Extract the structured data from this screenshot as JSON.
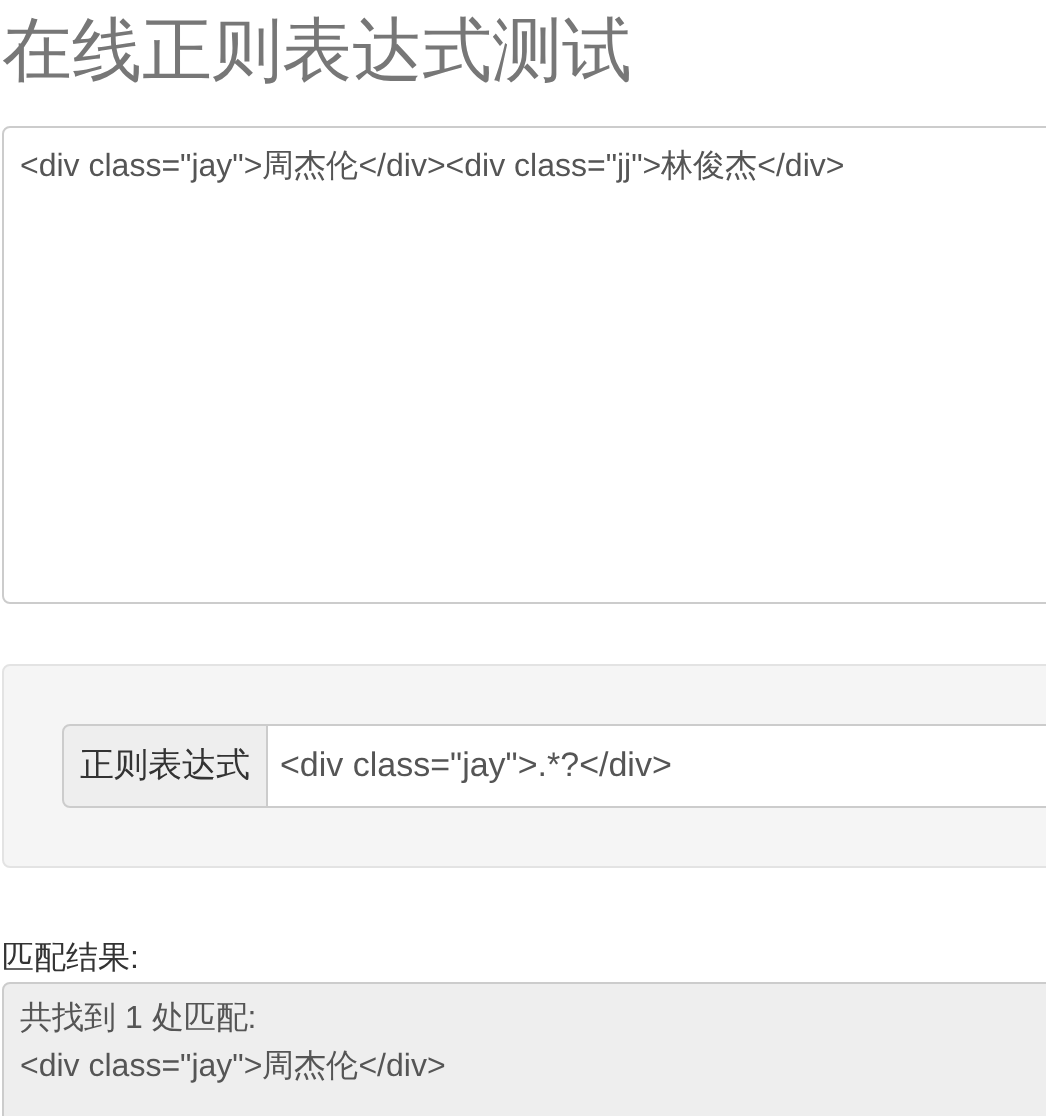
{
  "title": "在线正则表达式测试",
  "source_text": {
    "value": "<div class=\"jay\">周杰伦</div><div class=\"jj\">林俊杰</div>"
  },
  "regex": {
    "label": "正则表达式",
    "value": "<div class=\"jay\">.*?</div>"
  },
  "result": {
    "label": "匹配结果:",
    "lines": [
      "共找到 1 处匹配:",
      "<div class=\"jay\">周杰伦</div>"
    ]
  }
}
